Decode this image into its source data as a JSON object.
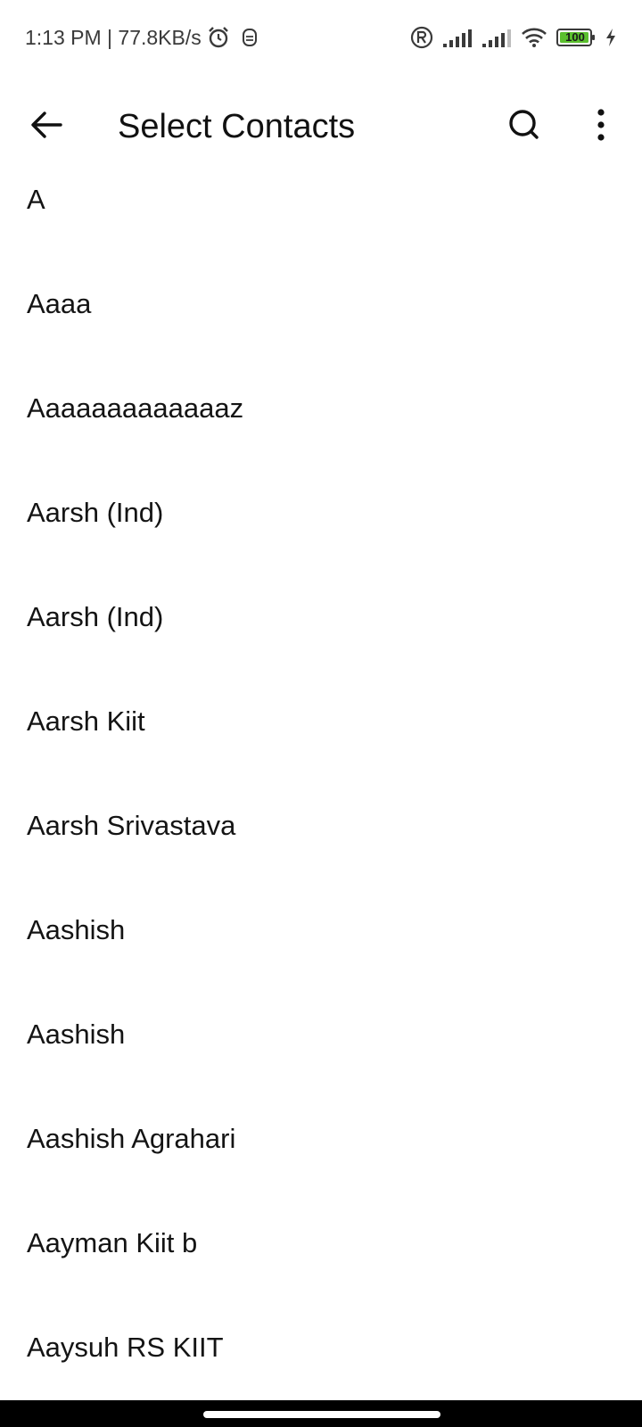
{
  "status_bar": {
    "time_speed": "1:13 PM | 77.8KB/s",
    "battery": "100"
  },
  "app_bar": {
    "title": "Select Contacts"
  },
  "contacts": [
    "A",
    "Aaaa",
    "Aaaaaaaaaaaaaz",
    "Aarsh (Ind)",
    "Aarsh (Ind)",
    "Aarsh Kiit",
    "Aarsh Srivastava",
    "Aashish",
    "Aashish",
    "Aashish Agrahari",
    "Aayman Kiit b",
    "Aaysuh RS KIIT"
  ],
  "colors": {
    "battery_fill": "#5bbf2e",
    "nav_bar": "#000000"
  }
}
